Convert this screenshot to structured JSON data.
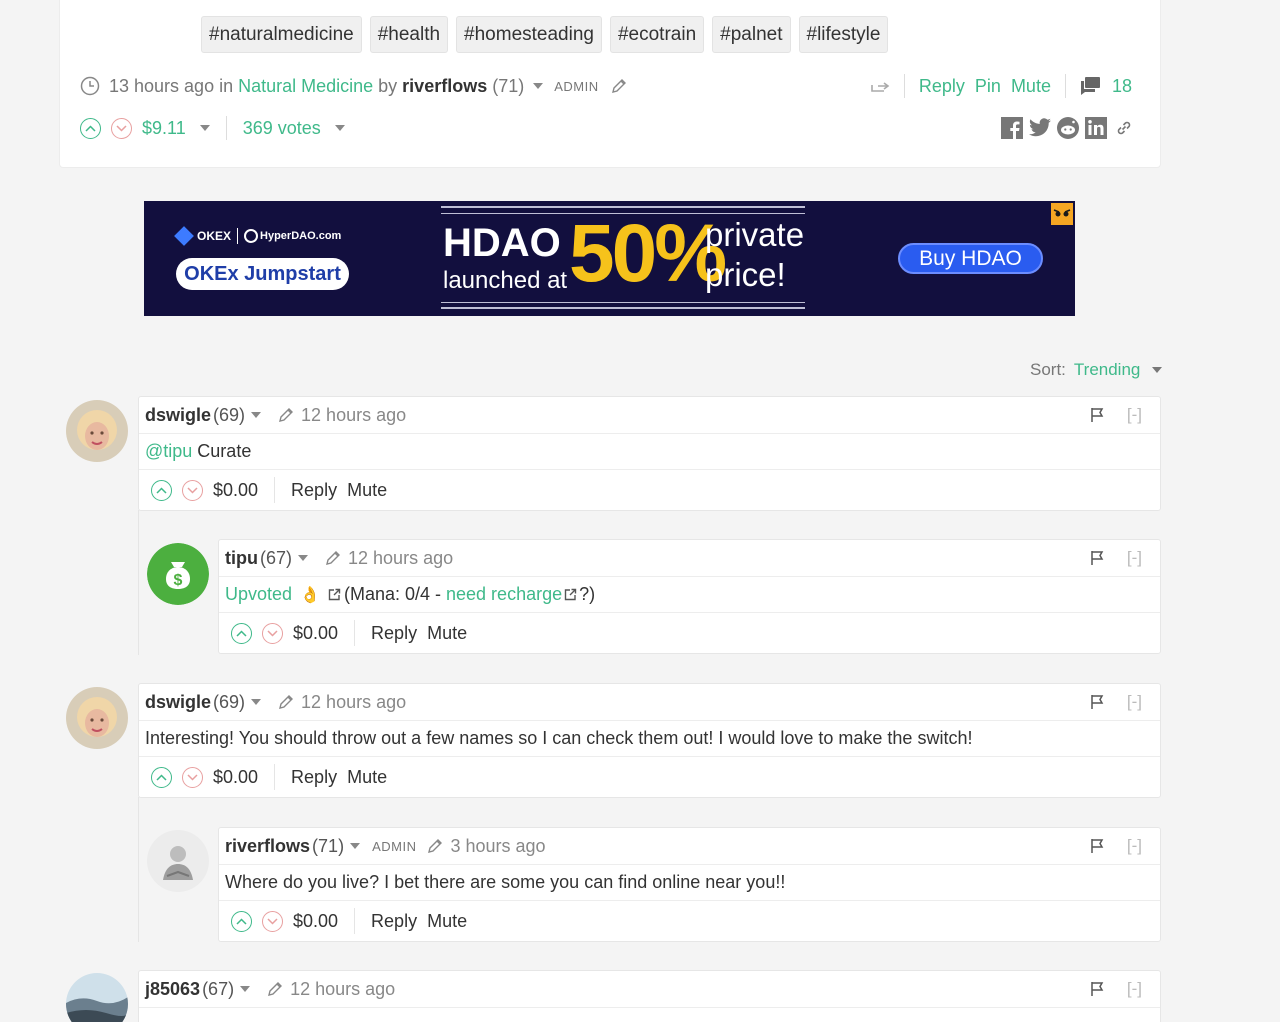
{
  "post": {
    "tags": [
      "#naturalmedicine",
      "#health",
      "#homesteading",
      "#ecotrain",
      "#palnet",
      "#lifestyle"
    ],
    "time": "13 hours ago in",
    "community": "Natural Medicine",
    "by": "by",
    "author": "riverflows",
    "author_rep": "(71)",
    "admin_badge": "ADMIN",
    "reply_label": "Reply",
    "pin_label": "Pin",
    "mute_label": "Mute",
    "comment_count": "18",
    "payout": "$9.11",
    "votes": "369 votes"
  },
  "ad": {
    "brand1": "OKEX",
    "brand2": "HyperDAO.com",
    "jumpstart": "OKEx Jumpstart",
    "hdao": "HDAO",
    "launched": "launched at",
    "percent": "50%",
    "private": "private",
    "price": "price!",
    "buy": "Buy HDAO"
  },
  "sort": {
    "label": "Sort:",
    "value": "Trending"
  },
  "comments": [
    {
      "author": "dswigle",
      "rep": "(69)",
      "time": "12 hours ago",
      "mention": "@tipu",
      "body": " Curate",
      "payout": "$0.00",
      "reply": "Reply",
      "mute": "Mute",
      "collapse": "[-]"
    },
    {
      "author": "tipu",
      "rep": "(67)",
      "time": "12 hours ago",
      "upvoted": "Upvoted",
      "emoji": "👌",
      "mana": "(Mana: 0/4 - ",
      "recharge": "need recharge",
      "mana_end": "?)",
      "payout": "$0.00",
      "reply": "Reply",
      "mute": "Mute",
      "collapse": "[-]"
    },
    {
      "author": "dswigle",
      "rep": "(69)",
      "time": "12 hours ago",
      "body": "Interesting! You should throw out a few names so I can check them out! I would love to make the switch!",
      "payout": "$0.00",
      "reply": "Reply",
      "mute": "Mute",
      "collapse": "[-]"
    },
    {
      "author": "riverflows",
      "rep": "(71)",
      "badge": "ADMIN",
      "time": "3 hours ago",
      "body": "Where do you live? I bet there are some you can find online near you!!",
      "payout": "$0.00",
      "reply": "Reply",
      "mute": "Mute",
      "collapse": "[-]"
    },
    {
      "author": "j85063",
      "rep": "(67)",
      "time": "12 hours ago",
      "collapse": "[-]"
    }
  ]
}
